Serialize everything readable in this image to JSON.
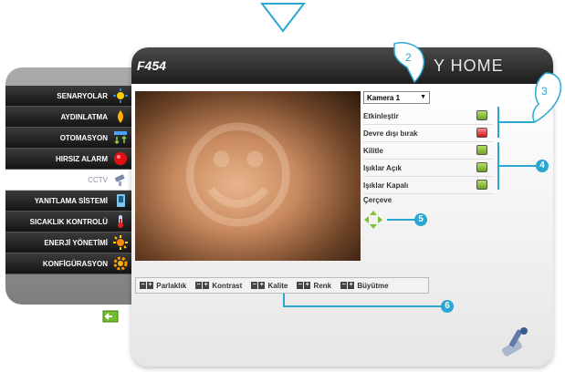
{
  "app": {
    "title": "F454",
    "brand": "Y HOME"
  },
  "sidebar": {
    "items": [
      {
        "label": "SENARYOLAR",
        "icon": "scenario-icon"
      },
      {
        "label": "AYDINLATMA",
        "icon": "lightbulb-icon"
      },
      {
        "label": "OTOMASYON",
        "icon": "automation-icon"
      },
      {
        "label": "HIRSIZ ALARM",
        "icon": "alarm-icon"
      },
      {
        "label": "CCTV",
        "icon": "cctv-camera-icon",
        "active": true
      },
      {
        "label": "YANITLAMA SİSTEMİ",
        "icon": "answering-icon"
      },
      {
        "label": "SICAKLIK KONTROLÜ",
        "icon": "thermometer-icon"
      },
      {
        "label": "ENERJİ YÖNETİMİ",
        "icon": "energy-icon"
      },
      {
        "label": "KONFİGÜRASYON",
        "icon": "gear-icon"
      }
    ]
  },
  "camera": {
    "selected": "Kamera 1"
  },
  "controls": [
    {
      "label": "Etkinleştir",
      "state": "green"
    },
    {
      "label": "Devre dışı bırak",
      "state": "red"
    },
    {
      "label": "Kilitle",
      "state": "green"
    },
    {
      "label": "Işıklar Açık",
      "state": "green"
    },
    {
      "label": "Işıklar Kapalı",
      "state": "green"
    }
  ],
  "frame": {
    "label": "Çerçeve"
  },
  "adjustments": [
    "Parlaklık",
    "Kontrast",
    "Kalite",
    "Renk",
    "Büyütme"
  ],
  "callouts": [
    "2",
    "3",
    "4",
    "5",
    "6"
  ],
  "colors": {
    "accent": "#2aa7d0",
    "header": "#2b2b2b",
    "sidebar_item": "#1e1e1e"
  }
}
